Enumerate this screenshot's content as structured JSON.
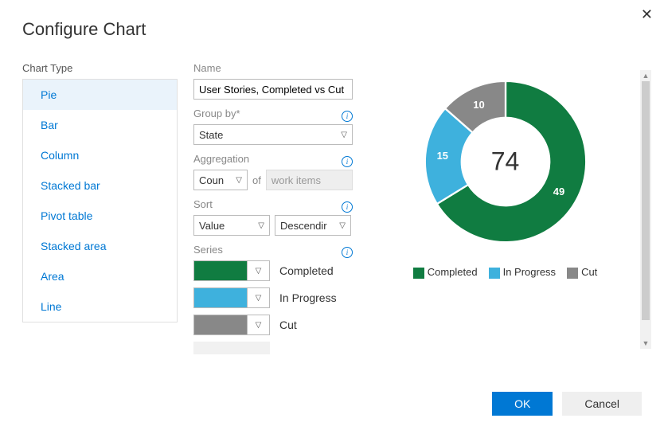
{
  "dialog": {
    "title": "Configure Chart"
  },
  "chart_type": {
    "label": "Chart Type",
    "selected": "Pie",
    "options": [
      "Pie",
      "Bar",
      "Column",
      "Stacked bar",
      "Pivot table",
      "Stacked area",
      "Area",
      "Line"
    ]
  },
  "form": {
    "name_label": "Name",
    "name_value": "User Stories, Completed vs Cut",
    "group_by_label": "Group by*",
    "group_by_value": "State",
    "aggregation_label": "Aggregation",
    "aggregation_value": "Coun",
    "of_text": "of",
    "of_value": "work items",
    "sort_label": "Sort",
    "sort_field": "Value",
    "sort_direction": "Descendir",
    "series_label": "Series",
    "series": [
      {
        "label": "Completed",
        "color": "#107c41"
      },
      {
        "label": "In Progress",
        "color": "#3eb1dd"
      },
      {
        "label": "Cut",
        "color": "#888888"
      }
    ]
  },
  "chart_data": {
    "type": "pie",
    "title": "",
    "total": 74,
    "series": [
      {
        "name": "Completed",
        "value": 49,
        "color": "#107c41"
      },
      {
        "name": "In Progress",
        "value": 15,
        "color": "#3eb1dd"
      },
      {
        "name": "Cut",
        "value": 10,
        "color": "#888888"
      }
    ]
  },
  "buttons": {
    "ok": "OK",
    "cancel": "Cancel"
  }
}
